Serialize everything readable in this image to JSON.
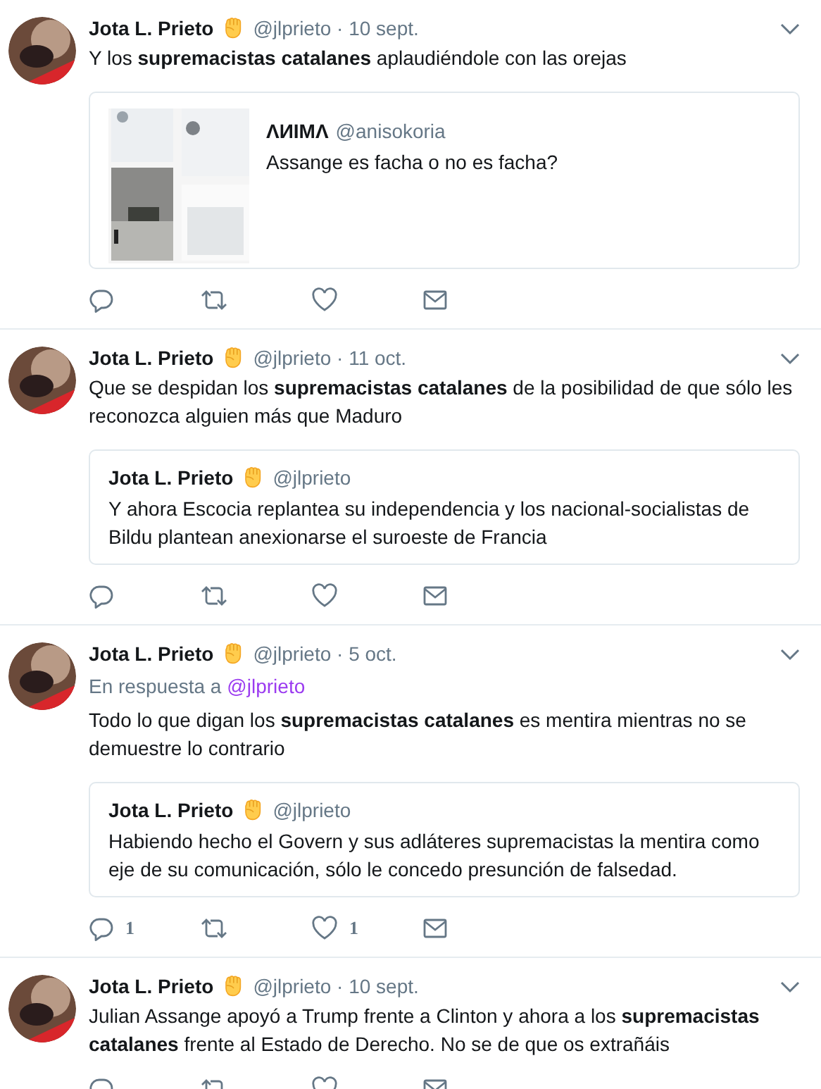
{
  "tweets": [
    {
      "author": "Jota L. Prieto",
      "meta": "@jlprieto · 10 sept.",
      "text": "Y los **supremacistas catalanes** aplaudiéndole con las orejas",
      "quote": {
        "kind": "picture",
        "author": "ΛИIMΛ",
        "handle": "@anisokoria",
        "text": "Assange es facha o no es facha?"
      },
      "actions": [
        {
          "kind": "reply"
        },
        {
          "kind": "retweet"
        },
        {
          "kind": "like"
        },
        {
          "kind": "message"
        }
      ]
    },
    {
      "author": "Jota L. Prieto",
      "meta": "@jlprieto · 11 oct.",
      "text": "Que se despidan los **supremacistas catalanes** de la posibilidad de que sólo les reconozca alguien más que Maduro",
      "quote": {
        "kind": "text",
        "author": "Jota L. Prieto",
        "handle": "@jlprieto",
        "text": "Y ahora Escocia replantea su independencia y los nacional-socialistas de Bildu plantean anexionarse el suroeste de Francia"
      },
      "actions": [
        {
          "kind": "reply"
        },
        {
          "kind": "retweet"
        },
        {
          "kind": "like"
        },
        {
          "kind": "message"
        }
      ]
    },
    {
      "author": "Jota L. Prieto",
      "meta": "@jlprieto · 5 oct.",
      "reply_label": "En respuesta a",
      "reply_to": "@jlprieto",
      "text": "Todo lo que digan los **supremacistas catalanes** es mentira mientras no se demuestre lo contrario",
      "quote": {
        "kind": "text",
        "author": "Jota L. Prieto",
        "handle": "@jlprieto",
        "text": "Habiendo hecho el Govern y sus adláteres supremacistas la mentira como eje de su comunicación, sólo le concedo presunción de falsedad."
      },
      "actions": [
        {
          "kind": "reply",
          "count": "1"
        },
        {
          "kind": "retweet"
        },
        {
          "kind": "like",
          "count": "1"
        },
        {
          "kind": "message"
        }
      ]
    },
    {
      "author": "Jota L. Prieto",
      "meta": "@jlprieto · 10 sept.",
      "text": "Julian Assange apoyó a Trump frente a Clinton y ahora a los **supremacistas catalanes** frente al Estado de Derecho. No se de que os extrañáis",
      "actions": [
        {
          "kind": "reply"
        },
        {
          "kind": "retweet"
        },
        {
          "kind": "like"
        },
        {
          "kind": "message"
        }
      ]
    }
  ]
}
